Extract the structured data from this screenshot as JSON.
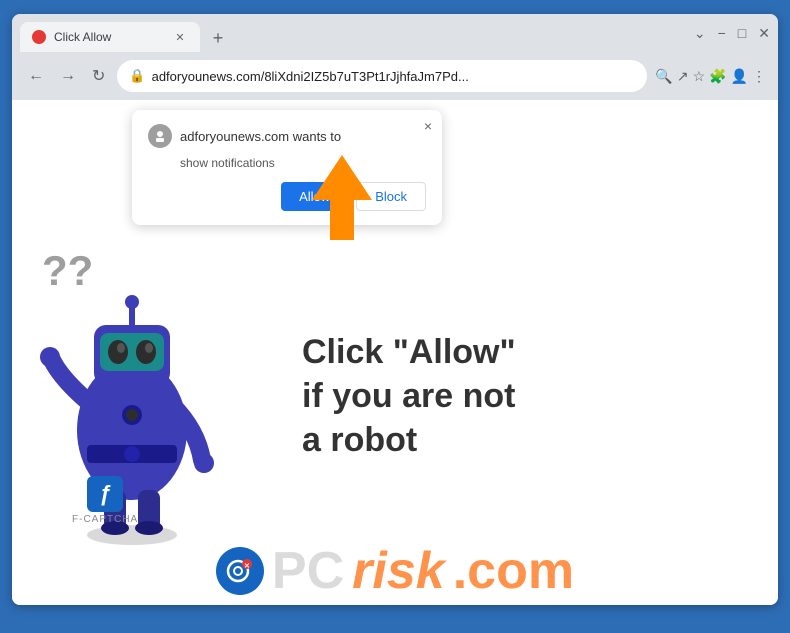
{
  "browser": {
    "tab_title": "Click Allow",
    "tab_favicon_color": "#e53935",
    "url": "adforyounews.com/8liXdni2IZ5b7uT3Pt1rJjhfaJm7Pd...",
    "new_tab_label": "+",
    "nav_back": "←",
    "nav_forward": "→",
    "nav_refresh": "↻"
  },
  "window_controls": {
    "minimize": "−",
    "maximize": "□",
    "close": "✕"
  },
  "notification_popup": {
    "title": "adforyounews.com wants to",
    "subtitle": "show notifications",
    "allow_label": "Allow",
    "block_label": "Block",
    "close_label": "×"
  },
  "page": {
    "captcha_line1": "Click \"Allow\"",
    "captcha_line2": "if you are not",
    "captcha_line3": "a robot",
    "fcaptcha_letter": "ƒ",
    "fcaptcha_label": "F-CAPTCHA"
  },
  "pcrisk": {
    "text_pc": "PC",
    "text_risk": "risk",
    "text_com": ".com"
  },
  "icons": {
    "search": "🔍",
    "share": "↗",
    "bookmark": "☆",
    "extensions": "🧩",
    "profile": "👤",
    "menu": "⋮",
    "lock": "🔒"
  }
}
